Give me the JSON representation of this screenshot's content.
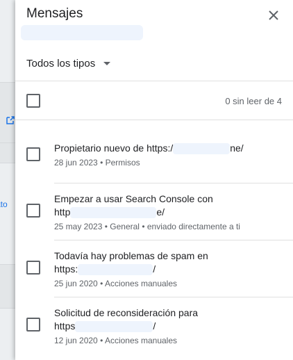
{
  "panel": {
    "title": "Mensajes",
    "close_icon": "close-icon"
  },
  "background": {
    "partial_text": "ato",
    "edit_icon": "open-in-new-icon"
  },
  "filter": {
    "label": "Todos los tipos",
    "icon": "caret-down-icon"
  },
  "list_header": {
    "unread_count": "0 sin leer de 4"
  },
  "messages": [
    {
      "title_line1": "Propietario nuevo de https:/",
      "title_line1_end": "ne/",
      "title_line2": "",
      "date": "28 jun 2023",
      "category": "Permisos",
      "extra": ""
    },
    {
      "title_line1": "Empezar a usar Search Console con",
      "title_line2": "http",
      "title_line2_end": "e/",
      "date": "25 may 2023",
      "category": "General",
      "extra": "enviado directamente a ti"
    },
    {
      "title_line1": "Todavía hay problemas de spam en",
      "title_line2": "https:",
      "title_line2_end": "/",
      "date": "25 jun 2020",
      "category": "Acciones manuales",
      "extra": ""
    },
    {
      "title_line1": "Solicitud de reconsideración para",
      "title_line2": "https",
      "title_line2_end": "/",
      "date": "12 jun 2020",
      "category": "Acciones manuales",
      "extra": ""
    }
  ],
  "meta_separator": "•",
  "colors": {
    "accent": "#1a73e8",
    "text_primary": "#202124",
    "text_secondary": "#5f6368",
    "divider": "#e0e0e0"
  }
}
